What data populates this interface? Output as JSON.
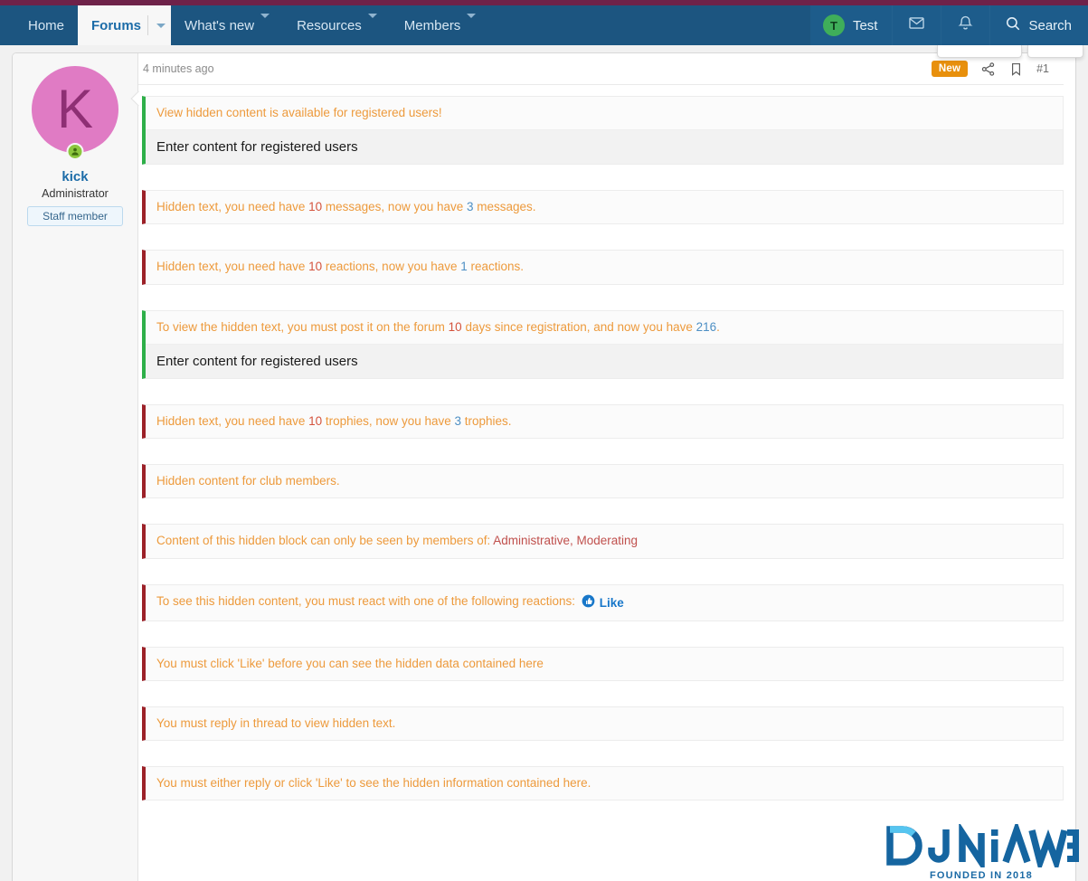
{
  "nav": {
    "items": [
      {
        "label": "Home",
        "has_caret": false,
        "active": false
      },
      {
        "label": "Forums",
        "has_caret": true,
        "active": true
      },
      {
        "label": "What's new",
        "has_caret": true,
        "active": false
      },
      {
        "label": "Resources",
        "has_caret": true,
        "active": false
      },
      {
        "label": "Members",
        "has_caret": true,
        "active": false
      }
    ],
    "user": {
      "name": "Test",
      "avatar_letter": "T"
    },
    "inbox_icon": "envelope-icon",
    "alerts_icon": "bell-icon",
    "search_label": "Search",
    "search_icon": "search-icon"
  },
  "author": {
    "avatar_letter": "K",
    "name": "kick",
    "title": "Administrator",
    "badge": "Staff member",
    "online_icon": "online-status-icon"
  },
  "post": {
    "time": "4 minutes ago",
    "new_badge": "New",
    "share_icon": "share-icon",
    "bookmark_icon": "bookmark-icon",
    "number": "#1"
  },
  "blocks": [
    {
      "accent": "green",
      "notice_parts": [
        {
          "text": "View hidden content is available for registered users!",
          "style": "base"
        }
      ],
      "content": "Enter content for registered users"
    },
    {
      "accent": "red",
      "notice_parts": [
        {
          "text": "Hidden text, you need have ",
          "style": "base"
        },
        {
          "text": "10",
          "style": "num"
        },
        {
          "text": " messages, now you have ",
          "style": "base"
        },
        {
          "text": "3",
          "style": "have"
        },
        {
          "text": " messages.",
          "style": "base"
        }
      ],
      "content": null
    },
    {
      "accent": "red",
      "notice_parts": [
        {
          "text": "Hidden text, you need have ",
          "style": "base"
        },
        {
          "text": "10",
          "style": "num"
        },
        {
          "text": " reactions, now you have ",
          "style": "base"
        },
        {
          "text": "1",
          "style": "have"
        },
        {
          "text": " reactions.",
          "style": "base"
        }
      ],
      "content": null
    },
    {
      "accent": "green",
      "notice_parts": [
        {
          "text": "To view the hidden text, you must post it on the forum ",
          "style": "base"
        },
        {
          "text": "10",
          "style": "num"
        },
        {
          "text": " days since registration, and now you have ",
          "style": "base"
        },
        {
          "text": "216",
          "style": "have"
        },
        {
          "text": ".",
          "style": "base"
        }
      ],
      "content": "Enter content for registered users"
    },
    {
      "accent": "red",
      "notice_parts": [
        {
          "text": "Hidden text, you need have ",
          "style": "base"
        },
        {
          "text": "10",
          "style": "num"
        },
        {
          "text": " trophies, now you have ",
          "style": "base"
        },
        {
          "text": "3",
          "style": "have"
        },
        {
          "text": " trophies.",
          "style": "base"
        }
      ],
      "content": null
    },
    {
      "accent": "red",
      "notice_parts": [
        {
          "text": "Hidden content for club members.",
          "style": "base"
        }
      ],
      "content": null
    },
    {
      "accent": "red",
      "notice_parts": [
        {
          "text": "Content of this hidden block can only be seen by members of: ",
          "style": "base"
        },
        {
          "text": "Administrative, Moderating",
          "style": "grp"
        }
      ],
      "content": null
    },
    {
      "accent": "red",
      "notice_parts": [
        {
          "text": "To see this hidden content, you must react with one of the following reactions: ",
          "style": "base"
        }
      ],
      "reaction": {
        "icon": "like-thumbs-up-icon",
        "label": "Like"
      },
      "content": null
    },
    {
      "accent": "red",
      "notice_parts": [
        {
          "text": "You must click 'Like' before you can see the hidden data contained here",
          "style": "base"
        }
      ],
      "content": null
    },
    {
      "accent": "red",
      "notice_parts": [
        {
          "text": "You must reply in thread to view hidden text.",
          "style": "base"
        }
      ],
      "content": null
    },
    {
      "accent": "red",
      "notice_parts": [
        {
          "text": "You must either reply or click 'Like' to see the hidden information contained here.",
          "style": "base"
        }
      ],
      "content": null
    }
  ],
  "watermark": {
    "brand": "DONIAWEB",
    "tagline": "FOUNDED IN 2018",
    "color_dark": "#1565a0",
    "color_light": "#56c5f0"
  },
  "colors": {
    "nav_bg": "#1c5580",
    "top_strip": "#6e2249",
    "accent_green": "#2eaf49",
    "accent_red": "#9c2128",
    "notice_orange": "#ed9a3c",
    "badge_orange": "#e8900c",
    "link_blue": "#1c6ca8"
  }
}
